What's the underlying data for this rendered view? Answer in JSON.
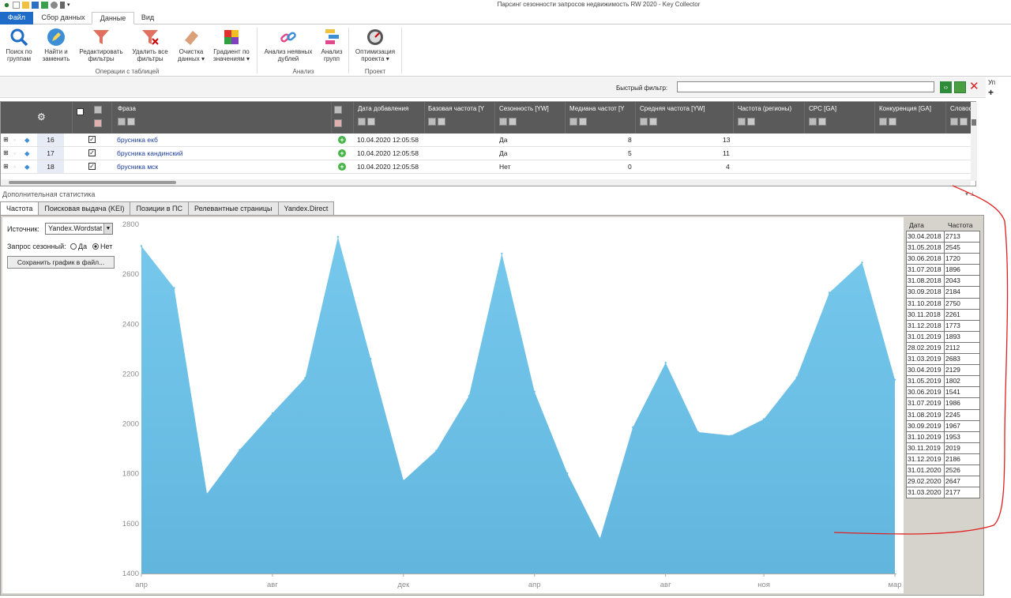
{
  "window": {
    "title": "Парсинг сезонности запросов недвижимость RW 2020 - Key Collector"
  },
  "ribbon": {
    "tabs": [
      "Файл",
      "Сбор данных",
      "Данные",
      "Вид"
    ],
    "buttons": [
      {
        "label1": "Поиск по",
        "label2": "группам",
        "icon": "search-icon"
      },
      {
        "label1": "Найти и",
        "label2": "заменить",
        "icon": "pencil-icon"
      },
      {
        "label1": "Редактировать",
        "label2": "фильтры",
        "icon": "filter-icon"
      },
      {
        "label1": "Удалить все",
        "label2": "фильтры",
        "icon": "filter-delete-icon"
      },
      {
        "label1": "Очистка",
        "label2": "данных ▾",
        "icon": "eraser-icon"
      },
      {
        "label1": "Градиент по",
        "label2": "значениям ▾",
        "icon": "gradient-icon"
      },
      {
        "label1": "Анализ неявных",
        "label2": "дублей",
        "icon": "link-icon"
      },
      {
        "label1": "Анализ",
        "label2": "групп",
        "icon": "groups-icon"
      },
      {
        "label1": "Оптимизация",
        "label2": "проекта ▾",
        "icon": "gauge-icon"
      }
    ],
    "groups": [
      "Операции с таблицей",
      "Анализ",
      "Проект"
    ]
  },
  "filter": {
    "label": "Быстрый фильтр:",
    "value": ""
  },
  "right_stub": "Уп",
  "grid": {
    "columns": [
      "Фраза",
      "Дата добавления",
      "Базовая частота [Y",
      "Сезонность [YW]",
      "Медиана частот [Y",
      "Средняя частота [YW]",
      "Частота (регионы)",
      "CPC [GA]",
      "Конкуренция [GA]",
      "Словоформы"
    ],
    "rows": [
      {
        "num": "16",
        "phrase": "брусника екб",
        "date": "10.04.2020 12:05:58",
        "season": "Да",
        "median": "8",
        "avg": "13"
      },
      {
        "num": "17",
        "phrase": "брусника кандинский",
        "date": "10.04.2020 12:05:58",
        "season": "Да",
        "median": "5",
        "avg": "11"
      },
      {
        "num": "18",
        "phrase": "брусника мск",
        "date": "10.04.2020 12:05:58",
        "season": "Нет",
        "median": "0",
        "avg": "4"
      }
    ]
  },
  "stats": {
    "title": "Дополнительная статистика",
    "tabs": [
      "Частота",
      "Поисковая выдача (KEI)",
      "Позиции в ПС",
      "Релевантные страницы",
      "Yandex.Direct"
    ],
    "source_label": "Источник:",
    "source_value": "Yandex.Wordstat",
    "seasonal_label": "Запрос сезонный:",
    "radio_yes": "Да",
    "radio_no": "Нет",
    "radio_selected": "Нет",
    "save_button": "Сохранить график в файл...",
    "table_head": {
      "date": "Дата",
      "freq": "Частота"
    }
  },
  "chart_data": {
    "type": "area",
    "x": [
      "30.04.2018",
      "31.05.2018",
      "30.06.2018",
      "31.07.2018",
      "31.08.2018",
      "30.09.2018",
      "31.10.2018",
      "30.11.2018",
      "31.12.2018",
      "31.01.2019",
      "28.02.2019",
      "31.03.2019",
      "30.04.2019",
      "31.05.2019",
      "30.06.2019",
      "31.07.2019",
      "31.08.2019",
      "30.09.2019",
      "31.10.2019",
      "30.11.2019",
      "31.12.2019",
      "31.01.2020",
      "29.02.2020",
      "31.03.2020"
    ],
    "values": [
      2713,
      2545,
      1720,
      1896,
      2043,
      2184,
      2750,
      2261,
      1773,
      1893,
      2112,
      2683,
      2129,
      1802,
      1541,
      1986,
      2245,
      1967,
      1953,
      2019,
      2186,
      2526,
      2647,
      2177
    ],
    "ylim": [
      1400,
      2800
    ],
    "yticks": [
      "2800",
      "2600",
      "2400",
      "2200",
      "2000",
      "1800",
      "1600",
      "1400"
    ],
    "xticks": [
      {
        "label": "апр",
        "index": 0
      },
      {
        "label": "авг",
        "index": 4
      },
      {
        "label": "дек",
        "index": 8
      },
      {
        "label": "апр",
        "index": 12
      },
      {
        "label": "авг",
        "index": 16
      },
      {
        "label": "ноя",
        "index": 19
      },
      {
        "label": "мар",
        "index": 23
      }
    ],
    "fill_color": "#6cc0e6",
    "grid": false
  },
  "colors": {
    "accent": "#1e6cc8",
    "header": "#5a5a5a",
    "annotation": "#e02020"
  }
}
